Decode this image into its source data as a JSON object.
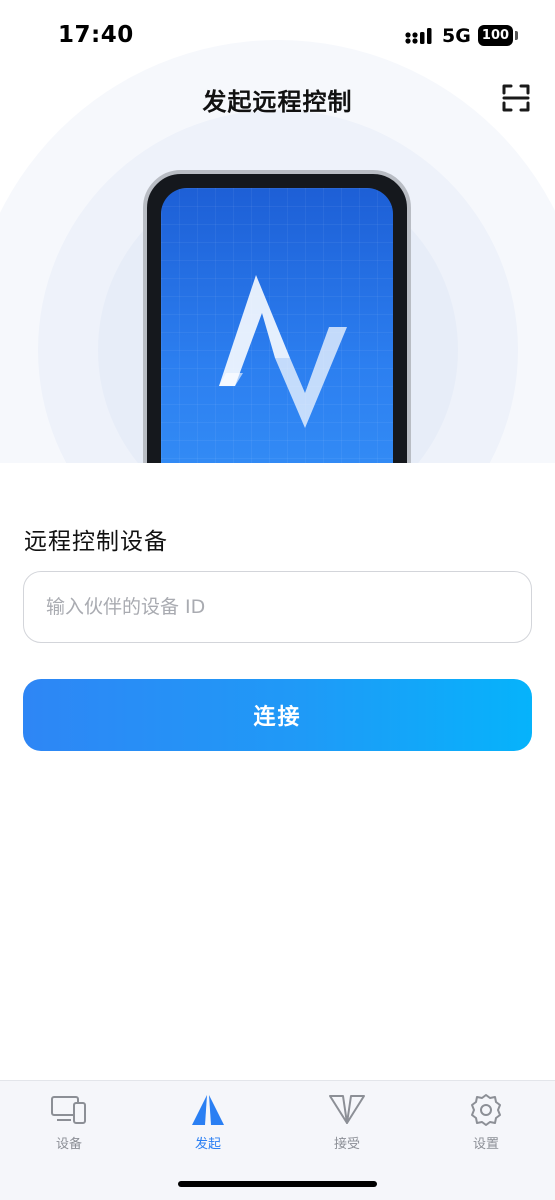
{
  "status_bar": {
    "time": "17:40",
    "network": "5G",
    "battery": "100",
    "icons": [
      "signal-icon",
      "battery-icon"
    ]
  },
  "header": {
    "title": "发起远程控制",
    "scan_icon": "scan-icon"
  },
  "hero": {
    "logo_icon": "av-logo-icon",
    "colors": {
      "screen_top": "#1d5fd6",
      "screen_bottom": "#3590f7",
      "frame": "#15181d"
    }
  },
  "form": {
    "section_label": "远程控制设备",
    "device_id": {
      "placeholder": "输入伙伴的设备 ID",
      "value": ""
    },
    "connect_label": "连接"
  },
  "tab_bar": {
    "tabs": [
      {
        "label": "设备",
        "icon": "devices-icon",
        "active": false
      },
      {
        "label": "发起",
        "icon": "initiate-icon",
        "active": true
      },
      {
        "label": "接受",
        "icon": "receive-icon",
        "active": false
      },
      {
        "label": "设置",
        "icon": "gear-icon",
        "active": false
      }
    ]
  },
  "colors": {
    "accent": "#2a7ff3",
    "button_start": "#2e86f5",
    "button_end": "#06b3fb",
    "inactive_tab": "#8c8f96"
  }
}
